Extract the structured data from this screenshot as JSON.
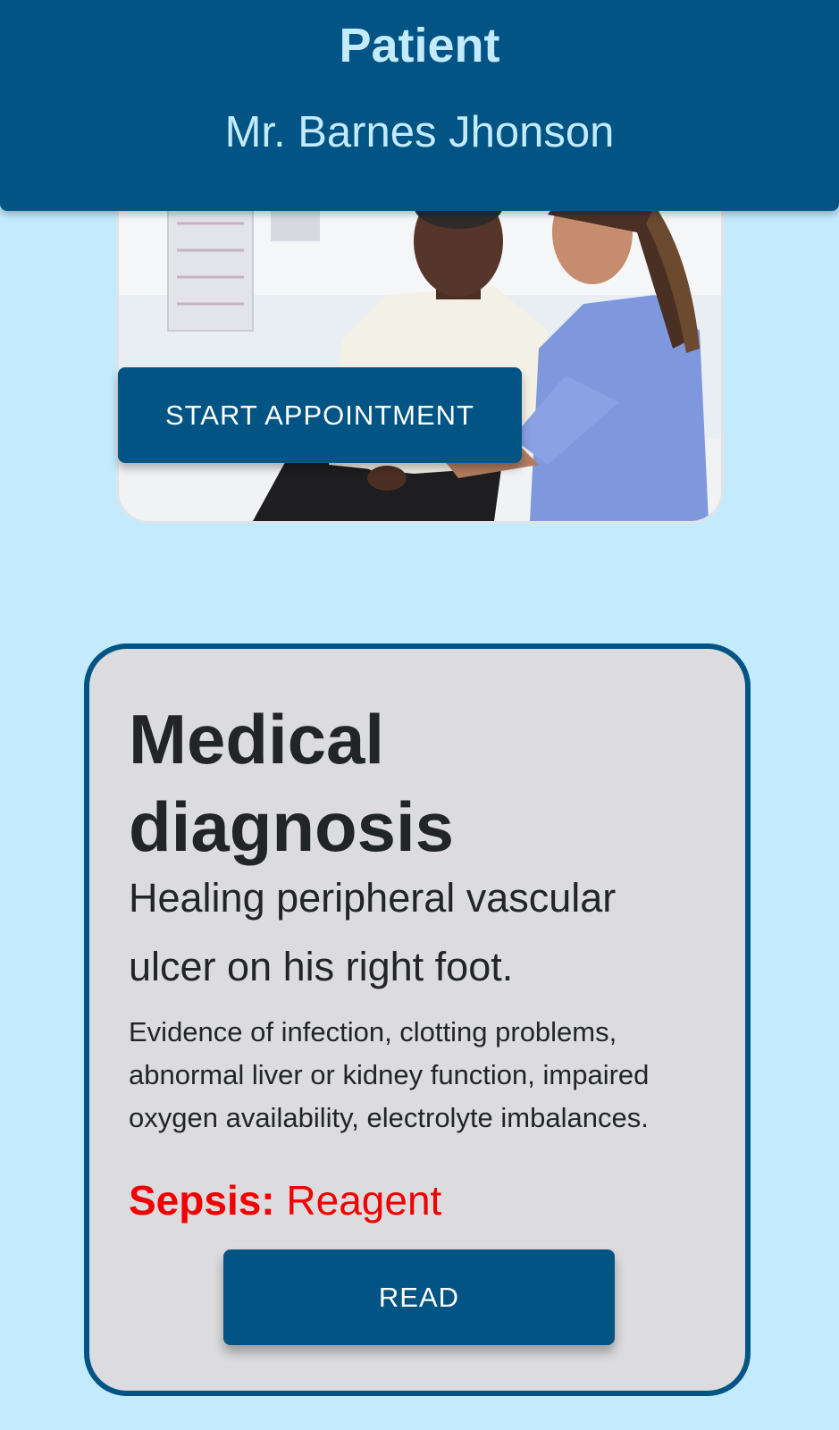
{
  "header": {
    "title": "Patient",
    "patient_name": "Mr. Barnes Jhonson"
  },
  "appointment": {
    "photo": "patient-with-nurse-photo",
    "start_button_label": "START APPOINTMENT"
  },
  "diagnosis": {
    "title": "Medical diagnosis",
    "main_text": "Healing peripheral vascular ulcer on his right foot.",
    "detail_text": "Evidence of infection, clotting problems, abnormal liver or kidney function, impaired oxygen availability, electrolyte imbalances.",
    "sepsis_label": "Sepsis:",
    "sepsis_value": "Reagent",
    "read_button_label": "READ"
  },
  "colors": {
    "primary": "#015483",
    "background": "#c3eafd",
    "card": "#dcdcde",
    "alert": "#f20000"
  }
}
